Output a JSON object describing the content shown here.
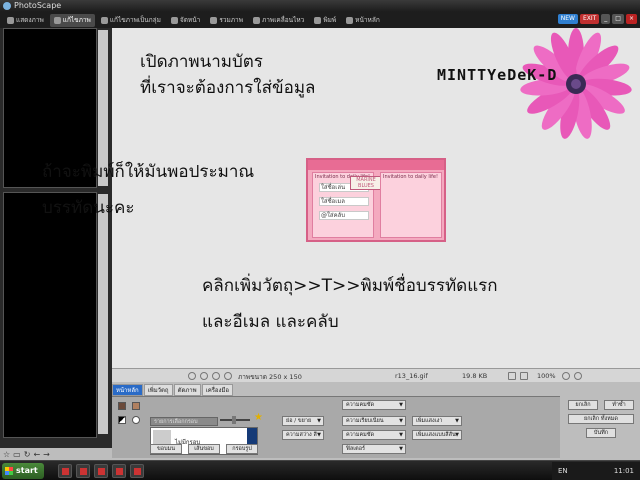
{
  "window": {
    "title": "PhotoScape"
  },
  "tabs": [
    {
      "label": "แสดงภาพ"
    },
    {
      "label": "แก้ไขภาพ",
      "active": true
    },
    {
      "label": "แก้ไขภาพเป็นกลุ่ม"
    },
    {
      "label": "จัดหน้า"
    },
    {
      "label": "รวมภาพ"
    },
    {
      "label": "ภาพเคลื่อนไหว"
    },
    {
      "label": "พิมพ์"
    },
    {
      "label": "หน้าหลัก"
    }
  ],
  "corner_buttons": [
    "NEW",
    "EXIT"
  ],
  "canvas": {
    "line1": "เปิดภาพนามบัตร",
    "line2": "ที่เราจะต้องการใส่ข้อมูล",
    "line3": "ถ้าจะพิมพ์ก็ให้มันพอประมาณ",
    "line4": "บรรทัดนะคะ",
    "line5": "คลิกเพิ่มวัตถุ>>T>>พิมพ์ชื่อบรรทัดแรก",
    "line6": "และอีเมล และคลับ",
    "watermark": "MINTTYeDeK-D"
  },
  "card": {
    "header_left": "Invitation to daily life!",
    "header_right": "Invitation to daily life!",
    "logo": "MARINE BLUES",
    "fields": [
      "ใส่ชื่อเล่น",
      "ใส่ชื่อเมล",
      "@ใส่คลับ"
    ]
  },
  "status": {
    "size": "ภาพขนาด 250 x 150",
    "filename": "r13_16.gif",
    "filesize": "19.8 KB",
    "zoom": "100%"
  },
  "panel": {
    "tabs": [
      "หน้าหลัก",
      "เพิ่มวัตถุ",
      "ตัดภาพ",
      "เครื่องมือ"
    ],
    "frame_dropdown": "รายการเลือกกรอบ",
    "frame_label": "ไม่มีกรอบ",
    "frame_buttons": [
      "ขอบมน",
      "เส้นขอบ",
      "กรอบรูป"
    ],
    "dropdowns": [
      "ความคมชัด",
      "ย่อ / ขยาย",
      "ความสว่าง สี",
      "ความเรียบเนียน",
      "ความคมชัด",
      "ฟิลเตอร์",
      "เพิ่มแสงเงา",
      "เพิ่มแสงแบบสีสัน"
    ],
    "right_buttons": [
      "ยกเลิก",
      "ทำซ้ำ",
      "ยกเลิก ทั้งหมด",
      "บันทึก"
    ]
  },
  "taskbar": {
    "start": "start",
    "lang": "EN",
    "clock": "11:01"
  }
}
